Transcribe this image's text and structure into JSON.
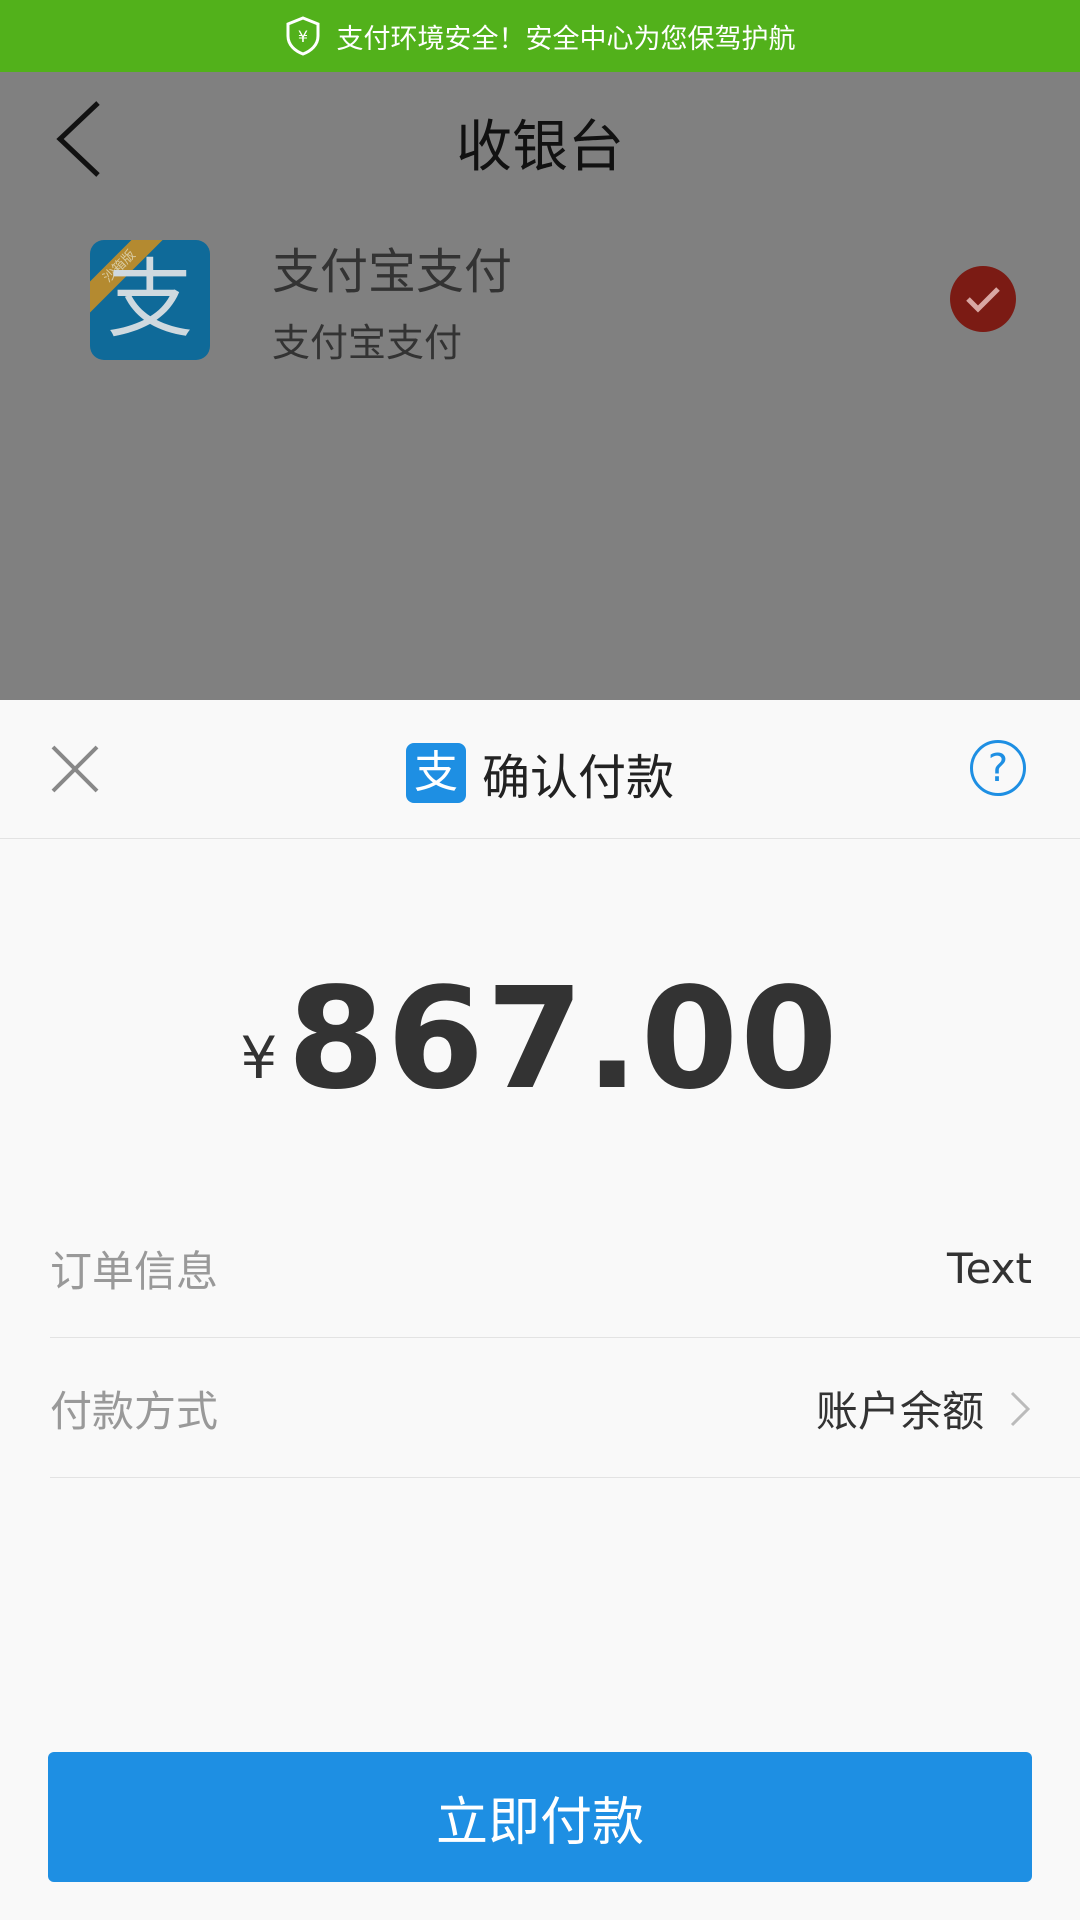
{
  "security_bar": {
    "text": "支付环境安全！安全中心为您保驾护航"
  },
  "cashier": {
    "title": "收银台",
    "method": {
      "name": "支付宝支付",
      "subtitle": "支付宝支付",
      "icon_glyph": "支",
      "ribbon": "沙箱版",
      "selected": true
    }
  },
  "sheet": {
    "title": "确认付款",
    "logo_glyph": "支",
    "help": "?",
    "amount": {
      "currency": "¥",
      "value": "867.00"
    },
    "rows": [
      {
        "label": "订单信息",
        "value": "Text"
      },
      {
        "label": "付款方式",
        "value": "账户余额"
      }
    ],
    "pay_button": "立即付款"
  },
  "colors": {
    "security_bar": "#52b11b",
    "overlay": "#808080",
    "accent": "#1e8fe3",
    "check": "#7b1b14"
  }
}
